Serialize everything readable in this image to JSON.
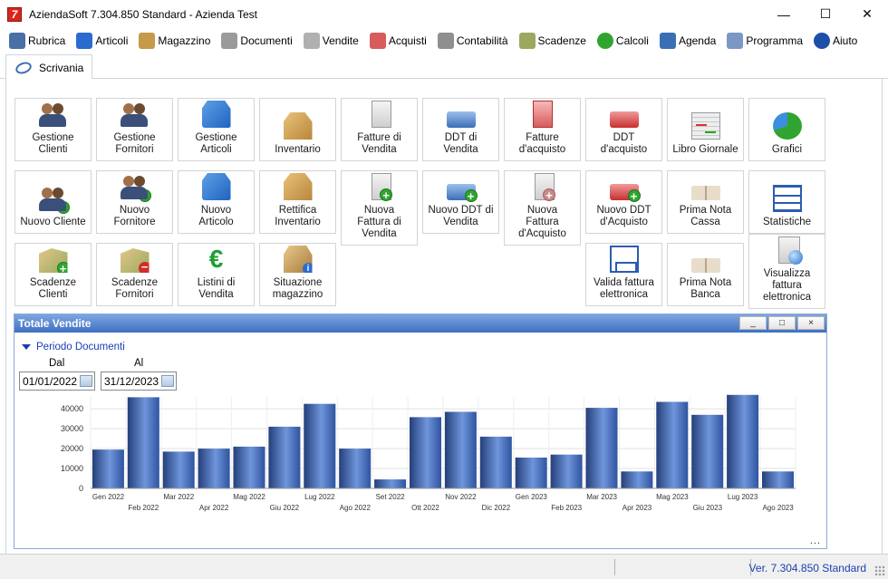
{
  "window": {
    "title": "AziendaSoft  7.304.850 Standard  - Azienda Test",
    "minimize": "—",
    "maximize": "☐",
    "close": "✕"
  },
  "menu": [
    {
      "label": "Rubrica",
      "icon": "address-book-icon",
      "color": "#4a6fa5"
    },
    {
      "label": "Articoli",
      "icon": "cubes-icon",
      "color": "#2a6bd0"
    },
    {
      "label": "Magazzino",
      "icon": "boxes-icon",
      "color": "#c59a4a"
    },
    {
      "label": "Documenti",
      "icon": "documents-icon",
      "color": "#9a9a9a"
    },
    {
      "label": "Vendite",
      "icon": "sales-doc-icon",
      "color": "#b0b0b0"
    },
    {
      "label": "Acquisti",
      "icon": "purchase-doc-icon",
      "color": "#d85c5c"
    },
    {
      "label": "Contabilità",
      "icon": "ledger-icon",
      "color": "#8f8f8f"
    },
    {
      "label": "Scadenze",
      "icon": "map-flag-icon",
      "color": "#9aa860"
    },
    {
      "label": "Calcoli",
      "icon": "pie-icon",
      "color": "#2fa52f"
    },
    {
      "label": "Agenda",
      "icon": "calendar-icon",
      "color": "#3b6fb5"
    },
    {
      "label": "Programma",
      "icon": "gear-icon",
      "color": "#7a98c6"
    },
    {
      "label": "Aiuto",
      "icon": "help-icon",
      "color": "#1e4fa8"
    }
  ],
  "tab": {
    "label": "Scrivania",
    "icon": "desk-icon"
  },
  "tiles": {
    "gestione_clienti": "Gestione\nClienti",
    "gestione_fornitori": "Gestione\nFornitori",
    "gestione_articoli": "Gestione\nArticoli",
    "inventario": "Inventario",
    "fatture_vendita": "Fatture di\nVendita",
    "ddt_vendita": "DDT di\nVendita",
    "fatture_acquisto": "Fatture\nd'acquisto",
    "ddt_acquisto": "DDT\nd'acquisto",
    "libro_giornale": "Libro Giornale",
    "grafici": "Grafici",
    "nuovo_cliente": "Nuovo Cliente",
    "nuovo_fornitore": "Nuovo\nFornitore",
    "nuovo_articolo": "Nuovo\nArticolo",
    "rettifica_inventario": "Rettifica\nInventario",
    "nuova_fattura_vendita": "Nuova\nFattura di\nVendita",
    "nuovo_ddt_vendita": "Nuovo DDT di\nVendita",
    "nuova_fattura_acquisto": "Nuova\nFattura\nd'Acquisto",
    "nuovo_ddt_acquisto": "Nuovo DDT\nd'Acquisto",
    "prima_nota_cassa": "Prima Nota\nCassa",
    "statistiche": "Statistiche",
    "scadenze_clienti": "Scadenze\nClienti",
    "scadenze_fornitori": "Scadenze\nFornitori",
    "listini_vendita": "Listini di\nVendita",
    "situazione_magazzino": "Situazione\nmagazzino",
    "valida_fattura": "Valida fattura\nelettronica",
    "prima_nota_banca": "Prima Nota\nBanca",
    "visualizza_fattura": "Visualizza\nfattura\nelettronica"
  },
  "panel": {
    "title": "Totale Vendite",
    "minimize": "_",
    "restore": "□",
    "close": "×",
    "periodo_label": "Periodo Documenti",
    "dal_label": "Dal",
    "al_label": "Al",
    "dal_value": "01/01/2022",
    "al_value": "31/12/2023",
    "more": "..."
  },
  "chart_data": {
    "type": "bar",
    "title": "",
    "xlabel": "",
    "ylabel": "",
    "ylim": [
      0,
      46000
    ],
    "yticks": [
      0,
      10000,
      20000,
      30000,
      40000
    ],
    "grid": true,
    "color": "#3a66b8",
    "categories": [
      "Gen 2022",
      "Feb 2022",
      "Mar 2022",
      "Apr 2022",
      "Mag 2022",
      "Giu 2022",
      "Lug 2022",
      "Ago 2022",
      "Set 2022",
      "Ott 2022",
      "Nov 2022",
      "Dic 2022",
      "Gen 2023",
      "Feb 2023",
      "Mar 2023",
      "Apr 2023",
      "Mag 2023",
      "Giu 2023",
      "Lug 2023",
      "Ago 2023"
    ],
    "values": [
      19500,
      45800,
      18500,
      20000,
      21000,
      31000,
      42500,
      20000,
      4500,
      35800,
      38500,
      26000,
      15500,
      17000,
      40500,
      8500,
      43500,
      37000,
      47000,
      8500
    ]
  },
  "status": {
    "version": "Ver. 7.304.850 Standard"
  }
}
